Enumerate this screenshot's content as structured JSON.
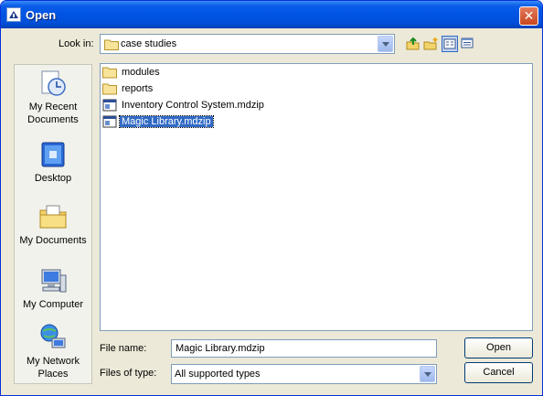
{
  "window": {
    "title": "Open"
  },
  "look_in": {
    "label": "Look in:",
    "value": "case studies"
  },
  "toolbar": {
    "icons": [
      "up-folder-icon",
      "new-folder-icon",
      "list-view-icon",
      "details-view-icon"
    ]
  },
  "places": [
    {
      "label": "My Recent Documents",
      "icon": "recent-documents-icon"
    },
    {
      "label": "Desktop",
      "icon": "desktop-icon"
    },
    {
      "label": "My Documents",
      "icon": "my-documents-icon"
    },
    {
      "label": "My Computer",
      "icon": "my-computer-icon"
    },
    {
      "label": "My Network Places",
      "icon": "network-places-icon"
    }
  ],
  "files": [
    {
      "name": "modules",
      "type": "folder"
    },
    {
      "name": "reports",
      "type": "folder"
    },
    {
      "name": "Inventory Control System.mdzip",
      "type": "file"
    },
    {
      "name": "Magic Library.mdzip",
      "type": "file",
      "selected": true
    }
  ],
  "file_name": {
    "label": "File name:",
    "value": "Magic Library.mdzip"
  },
  "file_type": {
    "label": "Files of type:",
    "value": "All supported types"
  },
  "buttons": {
    "open": "Open",
    "cancel": "Cancel"
  },
  "colors": {
    "titlebar": "#0054e3",
    "selection": "#316ac5",
    "dialog_bg": "#ece9d8"
  }
}
